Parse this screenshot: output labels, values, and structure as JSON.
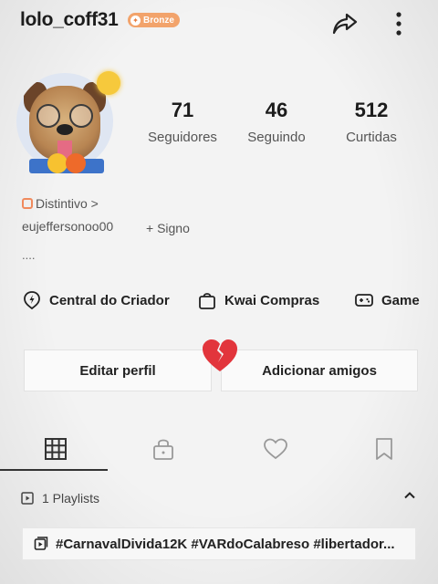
{
  "header": {
    "username": "lolo_coff31",
    "badge_label": "Bronze"
  },
  "stats": [
    {
      "count": "71",
      "label": "Seguidores"
    },
    {
      "count": "46",
      "label": "Seguindo"
    },
    {
      "count": "512",
      "label": "Curtidas"
    }
  ],
  "bio": {
    "distintivo_label": "Distintivo >",
    "handle": "eujeffersonoo00",
    "signo_label": "+ Signo",
    "ellipsis": "...."
  },
  "shortcuts": [
    {
      "label": "Central do Criador",
      "icon": "creator-center-icon"
    },
    {
      "label": "Kwai Compras",
      "icon": "shopping-bag-icon"
    },
    {
      "label": "Game",
      "icon": "gamepad-icon"
    }
  ],
  "buttons": {
    "edit_profile": "Editar perfil",
    "add_friends": "Adicionar amigos"
  },
  "tabs": [
    {
      "icon": "grid-icon",
      "active": true
    },
    {
      "icon": "lock-icon",
      "active": false
    },
    {
      "icon": "heart-icon",
      "active": false
    },
    {
      "icon": "bookmark-icon",
      "active": false
    }
  ],
  "playlists": {
    "header_label": "1 Playlists",
    "items": [
      {
        "title": "#CarnavalDivida12K #VARdoCalabreso #libertador..."
      }
    ]
  },
  "colors": {
    "badge": "#f2a36b",
    "broken_heart": "#e2353c",
    "background": "#f3f3f3"
  }
}
